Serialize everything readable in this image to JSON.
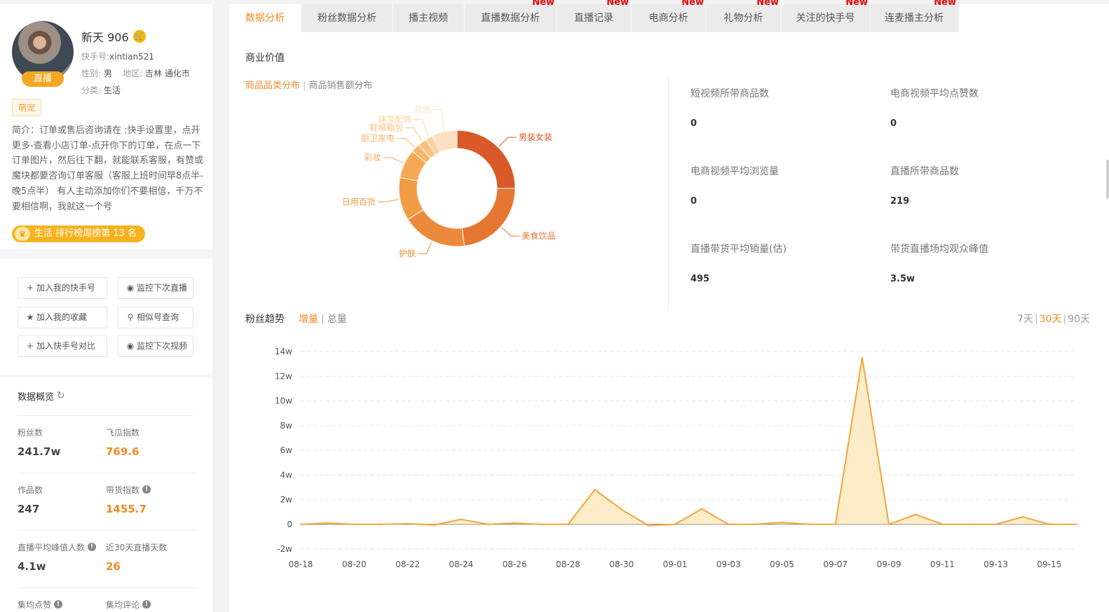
{
  "profile": {
    "name": "新天 906",
    "live_label": "直播",
    "kuaishou_id_label": "快手号:",
    "kuaishou_id": "xintian521",
    "gender_label": "性别:",
    "gender": "男",
    "region_label": "地区:",
    "region": "吉林 通化市",
    "category_label": "分类:",
    "category": "生活",
    "tag": "萌宠",
    "intro": "简介：订单或售后咨询请在 :快手设置里，点开更多-查看小店订单-点开你下的订单，在点一下订单图片，然后往下翻，就能联系客服，有赞或魔块都要咨询订单客服（客服上班时间早8点半-晚5点半） 有人主动添加你们不要相信，千万不要相信啊，我就这一个号",
    "rank_text": "生活 排行榜周榜第 13 名"
  },
  "actions": [
    {
      "label": "加入我的快手号",
      "icon": "plus-icon"
    },
    {
      "label": "监控下次直播",
      "icon": "eye-icon"
    },
    {
      "label": "加入我的收藏",
      "icon": "star-icon"
    },
    {
      "label": "相似号查询",
      "icon": "search-icon"
    },
    {
      "label": "加入快手号对比",
      "icon": "plus-icon"
    },
    {
      "label": "监控下次视频",
      "icon": "eye-icon"
    }
  ],
  "overview": {
    "title": "数据概览",
    "stats": [
      {
        "label": "粉丝数",
        "value": "241.7w"
      },
      {
        "label": "飞瓜指数",
        "value": "769.6"
      },
      {
        "label": "作品数",
        "value": "247"
      },
      {
        "label": "带货指数",
        "value": "1455.7"
      },
      {
        "label": "直播平均峰值人数",
        "value": "4.1w"
      },
      {
        "label": "近30天直播天数",
        "value": "26"
      },
      {
        "label": "集均点赞",
        "value": ""
      },
      {
        "label": "集均评论",
        "value": ""
      }
    ]
  },
  "tabs": [
    {
      "label": "数据分析",
      "new": ""
    },
    {
      "label": "粉丝数据分析",
      "new": ""
    },
    {
      "label": "播主视频",
      "new": ""
    },
    {
      "label": "直播数据分析",
      "new": "New"
    },
    {
      "label": "直播记录",
      "new": "New"
    },
    {
      "label": "电商分析",
      "new": "New"
    },
    {
      "label": "礼物分析",
      "new": "New"
    },
    {
      "label": "关注的快手号",
      "new": "New"
    },
    {
      "label": "连麦播主分析",
      "new": "New"
    }
  ],
  "business": {
    "title": "商业价值",
    "subtab_active": "商品品类分布",
    "subtab_sep": "|",
    "subtab_other": "商品销售额分布",
    "kpis": [
      {
        "label": "短视频所带商品数",
        "value": "0"
      },
      {
        "label": "电商视频平均点赞数",
        "value": "0"
      },
      {
        "label": "电商视频平均浏览量",
        "value": "0"
      },
      {
        "label": "直播所带商品数",
        "value": "219"
      },
      {
        "label": "直播带货平均销量(估)",
        "value": "495"
      },
      {
        "label": "带货直播场均观众峰值",
        "value": "3.5w"
      }
    ]
  },
  "category_chart": {
    "type": "pie",
    "slices": [
      {
        "name": "男装女装",
        "value": 25,
        "color": "#d95a28"
      },
      {
        "name": "美食饮品",
        "value": 23,
        "color": "#e57733"
      },
      {
        "name": "护肤",
        "value": 18,
        "color": "#ec8a3c"
      },
      {
        "name": "日用百货",
        "value": 12,
        "color": "#f29b45"
      },
      {
        "name": "彩妆",
        "value": 8,
        "color": "#f5a955"
      },
      {
        "name": "厨卫家电",
        "value": 2.5,
        "color": "#f7b46b"
      },
      {
        "name": "鞋帽箱包",
        "value": 2.5,
        "color": "#f9c283"
      },
      {
        "name": "珠宝配饰",
        "value": 2,
        "color": "#fbd09e"
      },
      {
        "name": "其他",
        "value": 7,
        "color": "#fde0bf"
      }
    ]
  },
  "trend": {
    "title": "粉丝趋势",
    "mode_active": "增量",
    "mode_sep": "|",
    "mode_other": "总量",
    "range": {
      "r7": "7天",
      "sep": "|",
      "r30": "30天",
      "r90": "90天"
    }
  },
  "chart_data": {
    "type": "area",
    "title": "",
    "xlabel": "",
    "ylabel": "",
    "ylim": [
      -2,
      14
    ],
    "y_ticks": [
      "-2w",
      "0",
      "2w",
      "4w",
      "6w",
      "8w",
      "10w",
      "12w",
      "14w"
    ],
    "x_tick_labels": [
      "08-18",
      "08-20",
      "08-22",
      "08-24",
      "08-26",
      "08-28",
      "08-30",
      "09-01",
      "09-03",
      "09-05",
      "09-07",
      "09-09",
      "09-11",
      "09-13",
      "09-15"
    ],
    "x": [
      "08-18",
      "08-19",
      "08-20",
      "08-21",
      "08-22",
      "08-23",
      "08-24",
      "08-25",
      "08-26",
      "08-27",
      "08-28",
      "08-29",
      "08-30",
      "08-31",
      "09-01",
      "09-02",
      "09-03",
      "09-04",
      "09-05",
      "09-06",
      "09-07",
      "09-08",
      "09-09",
      "09-10",
      "09-11",
      "09-12",
      "09-13",
      "09-14",
      "09-15",
      "09-16"
    ],
    "series": [
      {
        "values": [
          0,
          0.1,
          0,
          0,
          0.05,
          -0.05,
          0.4,
          0,
          0.1,
          0,
          0,
          2.8,
          1.2,
          -0.1,
          0,
          1.25,
          0,
          0,
          0.15,
          0,
          0,
          13.5,
          0,
          0.8,
          0,
          0,
          0,
          0.6,
          0,
          0
        ],
        "color": "#f5a43c",
        "fill": "#fdecc8"
      }
    ]
  }
}
